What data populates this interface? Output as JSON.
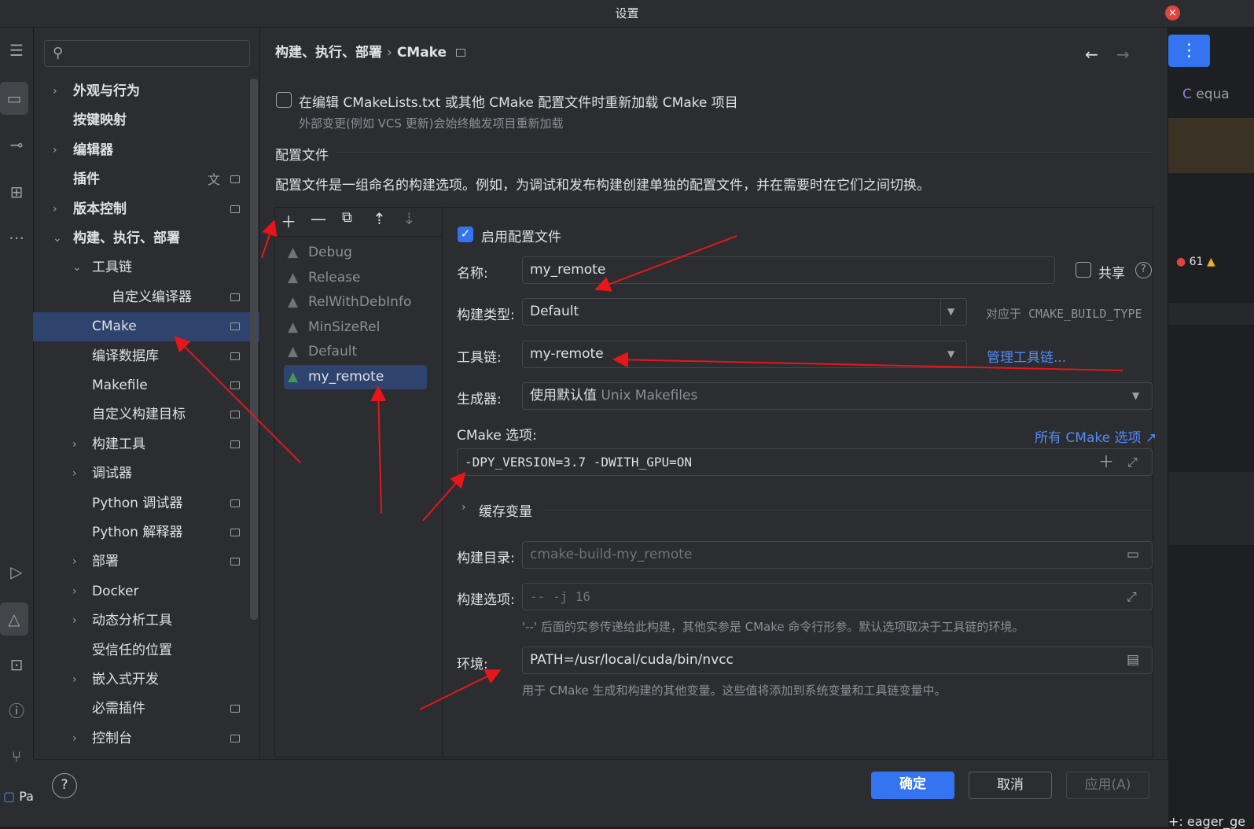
{
  "window": {
    "title": "设置"
  },
  "left_toolbar": {
    "icons": [
      "menu-icon",
      "folder-icon",
      "commit-icon",
      "structure-icon",
      "more-icon",
      "run-icon",
      "cmake-icon",
      "terminal-icon",
      "problems-icon",
      "git-icon"
    ]
  },
  "right_peek": {
    "tab_label": "equa",
    "error_count": "61",
    "bottom_left": "Pa",
    "bottom_right": "+: eager_ge"
  },
  "search": {
    "placeholder": ""
  },
  "tree": [
    {
      "label": "外观与行为",
      "expandable": true,
      "expanded": false,
      "level": 0
    },
    {
      "label": "按键映射",
      "expandable": false,
      "level": 0
    },
    {
      "label": "编辑器",
      "expandable": true,
      "expanded": false,
      "level": 0
    },
    {
      "label": "插件",
      "expandable": false,
      "level": 0
    },
    {
      "label": "版本控制",
      "expandable": true,
      "expanded": false,
      "level": 0
    },
    {
      "label": "构建、执行、部署",
      "expandable": true,
      "expanded": true,
      "level": 0
    },
    {
      "label": "工具链",
      "expandable": true,
      "expanded": true,
      "level": 1
    },
    {
      "label": "自定义编译器",
      "expandable": false,
      "level": 2
    },
    {
      "label": "CMake",
      "expandable": false,
      "level": 1,
      "selected": true
    },
    {
      "label": "编译数据库",
      "expandable": false,
      "level": 1
    },
    {
      "label": "Makefile",
      "expandable": false,
      "level": 1
    },
    {
      "label": "自定义构建目标",
      "expandable": false,
      "level": 1
    },
    {
      "label": "构建工具",
      "expandable": true,
      "expanded": false,
      "level": 1
    },
    {
      "label": "调试器",
      "expandable": true,
      "expanded": false,
      "level": 1
    },
    {
      "label": "Python 调试器",
      "expandable": false,
      "level": 1
    },
    {
      "label": "Python 解释器",
      "expandable": false,
      "level": 1
    },
    {
      "label": "部署",
      "expandable": true,
      "expanded": false,
      "level": 1
    },
    {
      "label": "Docker",
      "expandable": true,
      "expanded": false,
      "level": 1
    },
    {
      "label": "动态分析工具",
      "expandable": true,
      "expanded": false,
      "level": 1
    },
    {
      "label": "受信任的位置",
      "expandable": false,
      "level": 1
    },
    {
      "label": "嵌入式开发",
      "expandable": true,
      "expanded": false,
      "level": 1
    },
    {
      "label": "必需插件",
      "expandable": false,
      "level": 1
    },
    {
      "label": "控制台",
      "expandable": true,
      "expanded": false,
      "level": 1
    }
  ],
  "breadcrumb": {
    "parent": "构建、执行、部署",
    "current": "CMake"
  },
  "reload": {
    "label": "在编辑 CMakeLists.txt 或其他 CMake 配置文件时重新加载 CMake 项目",
    "hint": "外部变更(例如 VCS 更新)会始终触发项目重新加载",
    "checked": false
  },
  "profiles_section": {
    "title": "配置文件",
    "description": "配置文件是一组命名的构建选项。例如，为调试和发布构建创建单独的配置文件，并在需要时在它们之间切换。"
  },
  "profiles": [
    {
      "name": "Debug",
      "selected": false
    },
    {
      "name": "Release",
      "selected": false
    },
    {
      "name": "RelWithDebInfo",
      "selected": false
    },
    {
      "name": "MinSizeRel",
      "selected": false
    },
    {
      "name": "Default",
      "selected": false
    },
    {
      "name": "my_remote",
      "selected": true
    }
  ],
  "profile_form": {
    "enable_label": "启用配置文件",
    "enable_checked": true,
    "name_label": "名称:",
    "name_value": "my_remote",
    "share_label": "共享",
    "build_type_label": "构建类型:",
    "build_type_value": "Default",
    "build_type_hint": "对应于 CMAKE_BUILD_TYPE",
    "toolchain_label": "工具链:",
    "toolchain_value": "my-remote",
    "manage_toolchains": "管理工具链...",
    "generator_label": "生成器:",
    "generator_value": "使用默认值",
    "generator_hint": "Unix Makefiles",
    "cmake_options_label": "CMake 选项:",
    "all_cmake_options": "所有 CMake 选项 ↗",
    "cmake_options_value": "-DPY_VERSION=3.7 -DWITH_GPU=ON",
    "cache_vars_label": "缓存变量",
    "build_dir_label": "构建目录:",
    "build_dir_placeholder": "cmake-build-my_remote",
    "build_opts_label": "构建选项:",
    "build_opts_placeholder": "-- -j 16",
    "build_opts_hint": "'--' 后面的实参传递给此构建，其他实参是 CMake 命令行形参。默认选项取决于工具链的环境。",
    "env_label": "环境:",
    "env_value": "PATH=/usr/local/cuda/bin/nvcc",
    "env_hint": "用于 CMake 生成和构建的其他变量。这些值将添加到系统变量和工具链变量中。"
  },
  "buttons": {
    "ok": "确定",
    "cancel": "取消",
    "apply": "应用(A)",
    "help": "?"
  },
  "colors": {
    "accent": "#3574f0",
    "selection": "#2e436e",
    "annotation": "#e8161b",
    "link": "#548af7"
  }
}
